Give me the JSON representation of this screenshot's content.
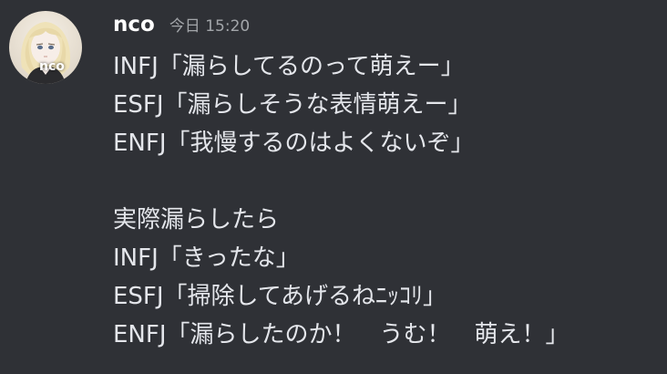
{
  "message": {
    "username": "nco",
    "timestamp": "今日 15:20",
    "avatar_label": "nco",
    "lines": [
      "INFJ「漏らしてるのって萌えー」",
      "ESFJ「漏らしそうな表情萌えー」",
      "ENFJ「我慢するのはよくないぞ」",
      "",
      "実際漏らしたら",
      "INFJ「きったな」",
      "ESFJ「掃除してあげるねﾆｯｺﾘ」",
      "ENFJ「漏らしたのか！　うむ！　萌え！」"
    ]
  },
  "colors": {
    "background": "#2f3136",
    "username": "#ffffff",
    "timestamp": "#a3a6aa",
    "text": "#e4e6eb"
  }
}
